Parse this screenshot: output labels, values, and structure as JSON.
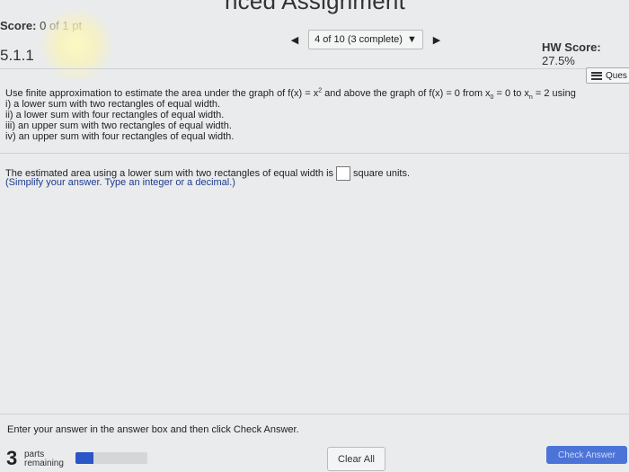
{
  "header": {
    "title": "nced Assignment",
    "score_label": "Score:",
    "score_value": "0",
    "score_of": "of 1 pt",
    "nav_position": "4 of 10 (3 complete)",
    "hw_score_label": "HW Score:",
    "hw_score_value": "27.5%",
    "section": "5.1.1",
    "question_button": "Ques"
  },
  "question": {
    "intro_a": "Use finite approximation to estimate the area under the graph of f(x) = x",
    "intro_exp": "2",
    "intro_b": " and above the graph of f(x) = 0 from x",
    "sub0": "0",
    "intro_c": " = 0 to x",
    "subn": "n",
    "intro_d": " = 2 using",
    "parts": [
      "i) a lower sum with two rectangles of equal width.",
      "ii) a lower sum with four rectangles of equal width.",
      "iii) an upper sum with two rectangles of equal width.",
      "iv) an upper sum with four rectangles of equal width."
    ]
  },
  "answer": {
    "prompt_before": "The estimated area using a lower sum with two rectangles of equal width is",
    "prompt_after": "square units.",
    "value": "",
    "hint": "(Simplify your answer. Type an integer or a decimal.)"
  },
  "footer": {
    "instruction": "Enter your answer in the answer box and then click Check Answer.",
    "parts_count": "3",
    "parts_label_1": "parts",
    "parts_label_2": "remaining",
    "progress": 0.25,
    "clear_label": "Clear All",
    "check_label": "Check Answer"
  },
  "colors": {
    "background": "#e9ebec",
    "hint": "#1f3b8f",
    "progress_fill": "#2c55c7",
    "check_button": "#4c74d8"
  },
  "icons": [
    "prev-arrow-icon",
    "next-arrow-icon",
    "dropdown-caret-icon",
    "question-list-icon"
  ]
}
